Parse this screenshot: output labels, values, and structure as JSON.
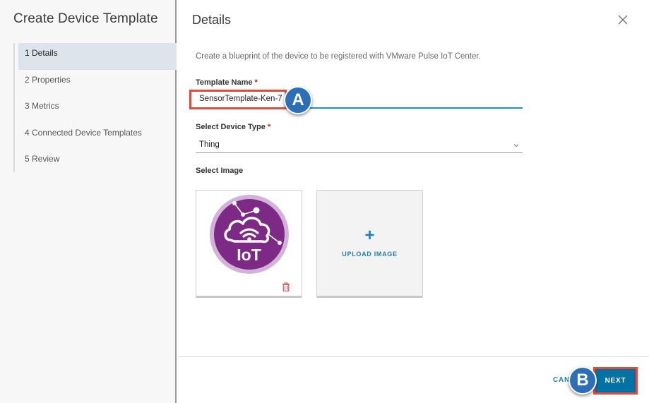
{
  "sidebar": {
    "title": "Create Device Template",
    "steps": [
      {
        "label": "1 Details",
        "active": true
      },
      {
        "label": "2 Properties",
        "active": false
      },
      {
        "label": "3 Metrics",
        "active": false
      },
      {
        "label": "4 Connected Device Templates",
        "active": false
      },
      {
        "label": "5 Review",
        "active": false
      }
    ]
  },
  "main": {
    "title": "Details",
    "description": "Create a blueprint of the device to be registered with VMware Pulse IoT Center.",
    "template_name": {
      "label": "Template Name",
      "required_mark": "*",
      "value": "SensorTemplate-Ken-7"
    },
    "device_type": {
      "label": "Select Device Type",
      "required_mark": "*",
      "value": "Thing"
    },
    "image": {
      "label": "Select Image",
      "iot_logo_text": "IoT",
      "upload_plus": "+",
      "upload_label": "UPLOAD IMAGE"
    }
  },
  "footer": {
    "cancel_label": "CAN",
    "next_label": "NEXT"
  },
  "annotations": {
    "a": "A",
    "b": "B"
  },
  "colors": {
    "accent": "#0072a3",
    "input_underline": "#1f8fd0",
    "highlight": "#e24b3b",
    "badge": "#2a6fb8",
    "iot_purple": "#7d2a86",
    "required": "#c92100"
  }
}
